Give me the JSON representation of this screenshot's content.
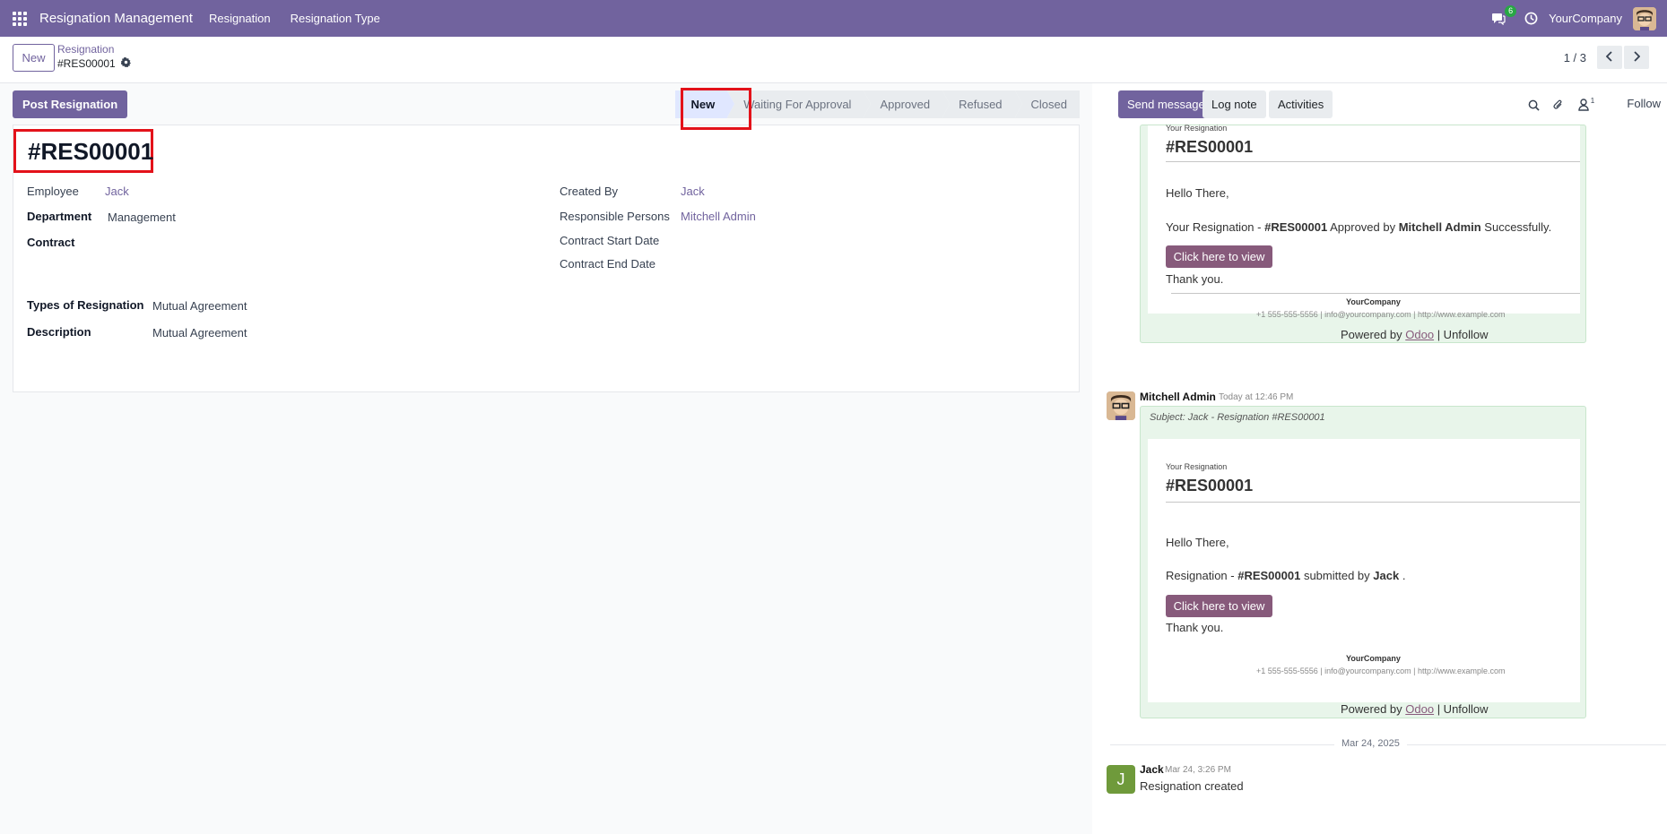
{
  "navbar": {
    "app_name": "Resignation Management",
    "menu": [
      "Resignation",
      "Resignation Type"
    ],
    "chat_count": "6",
    "company": "YourCompany"
  },
  "control": {
    "new_label": "New",
    "breadcrumb_parent": "Resignation",
    "breadcrumb_current": "#RES00001",
    "pager": "1 / 3"
  },
  "form": {
    "post_button": "Post Resignation",
    "stages": [
      "New",
      "Waiting For Approval",
      "Approved",
      "Refused",
      "Closed"
    ],
    "active_stage": "New",
    "title": "#RES00001",
    "fields": {
      "employee_label": "Employee",
      "employee_value": "Jack",
      "department_label": "Department",
      "department_value": "Management",
      "contract_label": "Contract",
      "types_label": "Types of Resignation",
      "types_value": "Mutual Agreement",
      "description_label": "Description",
      "description_value": "Mutual Agreement",
      "created_by_label": "Created By",
      "created_by_value": "Jack",
      "responsible_label": "Responsible Persons",
      "responsible_value": "Mitchell Admin",
      "contract_start_label": "Contract Start Date",
      "contract_end_label": "Contract End Date"
    }
  },
  "chatter": {
    "send_message": "Send message",
    "log_note": "Log note",
    "activities": "Activities",
    "followers_count": "1",
    "follow": "Follow",
    "messages": [
      {
        "mail_header": "Your Resignation",
        "mail_title": "#RES00001",
        "greeting": "Hello There,",
        "body_prefix": "Your Resignation - ",
        "body_ref": "#RES00001",
        "body_mid": " Approved by ",
        "body_person": "Mitchell Admin",
        "body_suffix": " Successfully.",
        "button": "Click here to view",
        "thanks": "Thank you.",
        "company": "YourCompany",
        "footer": "+1 555-555-5556 | info@yourcompany.com | http://www.example.com",
        "powered_by": "Powered by ",
        "powered_link": "Odoo",
        "unfollow": " | Unfollow"
      },
      {
        "author": "Mitchell Admin",
        "time": "Today at 12:46 PM",
        "subject": "Subject: Jack - Resignation #RES00001",
        "mail_header": "Your Resignation",
        "mail_title": "#RES00001",
        "greeting": "Hello There,",
        "body_prefix": "Resignation - ",
        "body_ref": "#RES00001",
        "body_mid": " submitted by ",
        "body_person": "Jack",
        "body_suffix": " .",
        "button": "Click here to view",
        "thanks": "Thank you.",
        "company": "YourCompany",
        "footer": "+1 555-555-5556 | info@yourcompany.com | http://www.example.com",
        "powered_by": "Powered by ",
        "powered_link": "Odoo",
        "unfollow": " | Unfollow"
      }
    ],
    "date_separator": "Mar 24, 2025",
    "last_message": {
      "avatar_letter": "J",
      "author": "Jack",
      "time": "Mar 24, 3:26 PM",
      "text": "Resignation created"
    }
  },
  "colors": {
    "brand": "#71639e",
    "mail_button": "#875a7b",
    "highlight": "#e3121a",
    "message_bg": "#e8f5ea"
  }
}
